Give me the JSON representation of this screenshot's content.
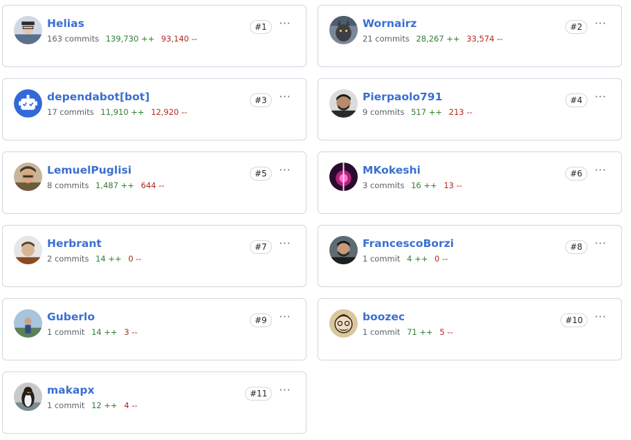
{
  "contributors": [
    {
      "name": "Helias",
      "commits": "163 commits",
      "additions": "139,730 ++",
      "deletions": "93,140 --",
      "rank": "#1",
      "more": "···",
      "avatar": "person-glasses"
    },
    {
      "name": "Wornairz",
      "commits": "21 commits",
      "additions": "28,267 ++",
      "deletions": "33,574 --",
      "rank": "#2",
      "more": "···",
      "avatar": "cat"
    },
    {
      "name": "dependabot[bot]",
      "commits": "17 commits",
      "additions": "11,910 ++",
      "deletions": "12,920 --",
      "rank": "#3",
      "more": "···",
      "avatar": "dependabot-robot"
    },
    {
      "name": "Pierpaolo791",
      "commits": "9 commits",
      "additions": "517 ++",
      "deletions": "213 --",
      "rank": "#4",
      "more": "···",
      "avatar": "person-dark"
    },
    {
      "name": "LemuelPuglisi",
      "commits": "8 commits",
      "additions": "1,487 ++",
      "deletions": "644 --",
      "rank": "#5",
      "more": "···",
      "avatar": "person-cap"
    },
    {
      "name": "MKokeshi",
      "commits": "3 commits",
      "additions": "16 ++",
      "deletions": "13 --",
      "rank": "#6",
      "more": "···",
      "avatar": "magenta-light"
    },
    {
      "name": "Herbrant",
      "commits": "2 commits",
      "additions": "14 ++",
      "deletions": "0 --",
      "rank": "#7",
      "more": "···",
      "avatar": "person-light"
    },
    {
      "name": "FrancescoBorzi",
      "commits": "1 commit",
      "additions": "4 ++",
      "deletions": "0 --",
      "rank": "#8",
      "more": "···",
      "avatar": "person-beard"
    },
    {
      "name": "Guberlo",
      "commits": "1 commit",
      "additions": "14 ++",
      "deletions": "3 --",
      "rank": "#9",
      "more": "···",
      "avatar": "person-outdoor"
    },
    {
      "name": "boozec",
      "commits": "1 commit",
      "additions": "71 ++",
      "deletions": "5 --",
      "rank": "#10",
      "more": "···",
      "avatar": "cartoon-face"
    },
    {
      "name": "makapx",
      "commits": "1 commit",
      "additions": "12 ++",
      "deletions": "4 --",
      "rank": "#11",
      "more": "···",
      "avatar": "penguin"
    }
  ],
  "colors": {
    "link": "#3b6fd1",
    "additions": "#2f7d32",
    "deletions": "#b3261e",
    "border": "#d0d7de"
  }
}
